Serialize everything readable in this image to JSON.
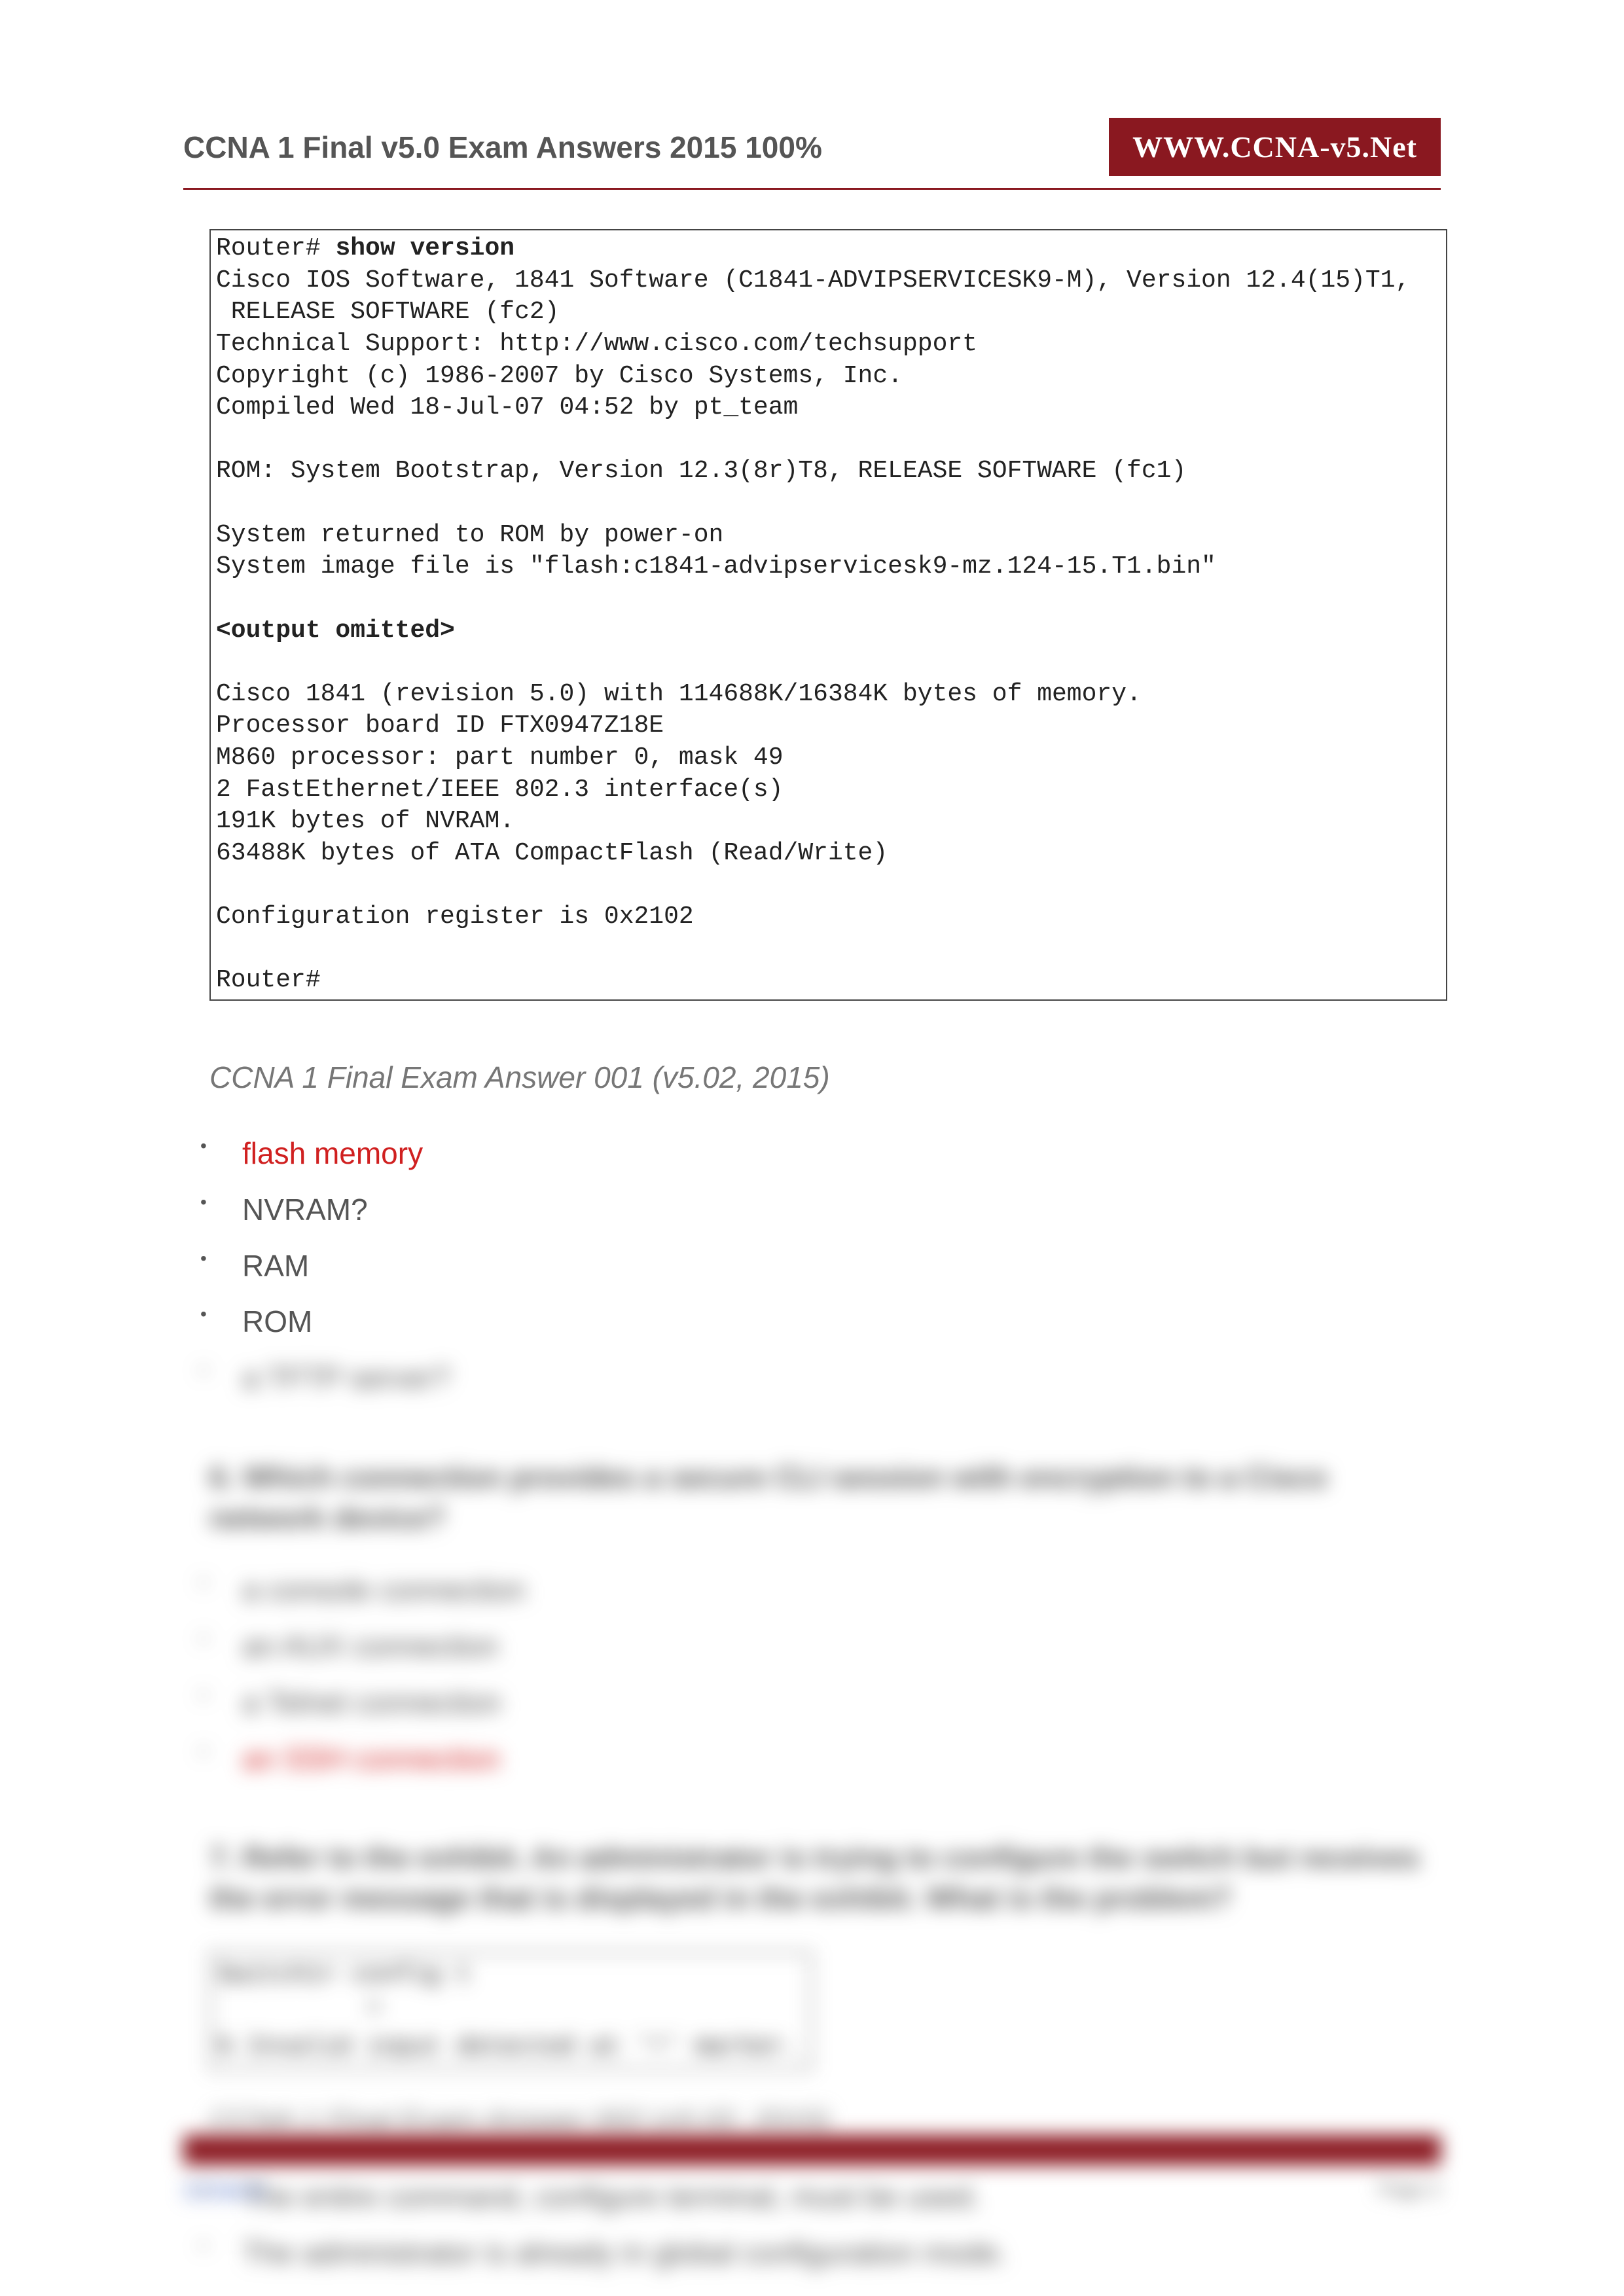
{
  "header": {
    "title": "CCNA 1 Final v5.0 Exam Answers 2015 100%",
    "site": "WWW.CCNA-v5.Net"
  },
  "terminal": {
    "prompt1": "Router# ",
    "cmd": "show version",
    "l1": "Cisco IOS Software, 1841 Software (C1841-ADVIPSERVICESK9-M), Version 12.4(15)T1,",
    "l2": " RELEASE SOFTWARE (fc2)",
    "l3": "Technical Support: http://www.cisco.com/techsupport",
    "l4": "Copyright (c) 1986-2007 by Cisco Systems, Inc.",
    "l5": "Compiled Wed 18-Jul-07 04:52 by pt_team",
    "blank": "",
    "l6": "ROM: System Bootstrap, Version 12.3(8r)T8, RELEASE SOFTWARE (fc1)",
    "l7": "System returned to ROM by power-on",
    "l8": "System image file is \"flash:c1841-advipservicesk9-mz.124-15.T1.bin\"",
    "omit": "<output omitted>",
    "l9": "Cisco 1841 (revision 5.0) with 114688K/16384K bytes of memory.",
    "l10": "Processor board ID FTX0947Z18E",
    "l11": "M860 processor: part number 0, mask 49",
    "l12": "2 FastEthernet/IEEE 802.3 interface(s)",
    "l13": "191K bytes of NVRAM.",
    "l14": "63488K bytes of ATA CompactFlash (Read/Write)",
    "l15": "Configuration register is 0x2102",
    "prompt2": "Router#"
  },
  "caption1": "CCNA 1 Final Exam Answer 001 (v5.02, 2015)",
  "q5options": {
    "a": "flash memory",
    "b": "NVRAM?",
    "c": "RAM",
    "d": "ROM",
    "e": "a TFTP server?"
  },
  "q6": {
    "text": "6. Which connection provides a secure CLI session with encryption to a Cisco network device?",
    "a": "a console connection",
    "b": "an AUX connection",
    "c": "a Telnet connection",
    "d": "an SSH connection"
  },
  "q7": {
    "text": "7. Refer to the exhibit. An administrator is trying to configure the switch but receives the error message that is displayed in the exhibit. What is the problem?",
    "term_l1": "Switch1> config t",
    "term_l2": "          ^",
    "term_l3": "% Invalid input detected at '^' marker.",
    "caption": "CCNA 1 Final Exam Answer 002 (v5.02, 2015)",
    "a": "The entire command, configure terminal, must be used.",
    "b": "The administrator is already in global configuration mode."
  },
  "footer": {
    "link": "CCNA 5",
    "page": "Page 2"
  }
}
